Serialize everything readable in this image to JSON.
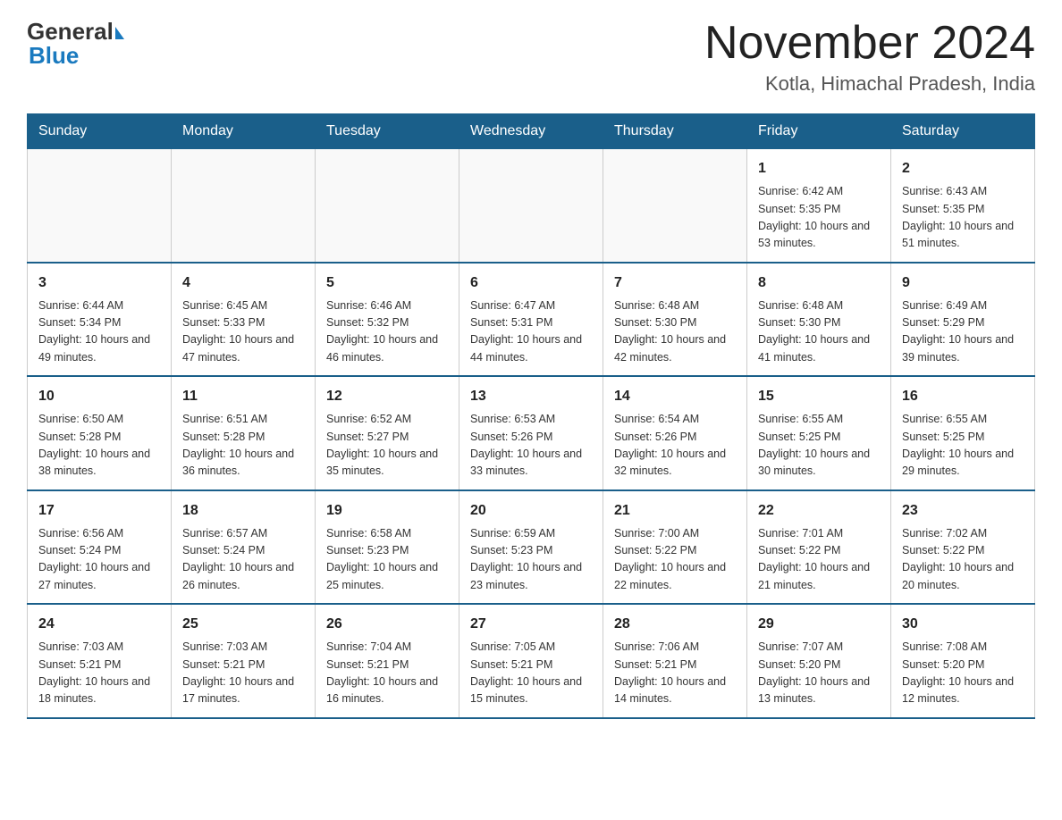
{
  "header": {
    "logo": {
      "general": "General",
      "blue": "Blue"
    },
    "title": "November 2024",
    "subtitle": "Kotla, Himachal Pradesh, India"
  },
  "calendar": {
    "days_of_week": [
      "Sunday",
      "Monday",
      "Tuesday",
      "Wednesday",
      "Thursday",
      "Friday",
      "Saturday"
    ],
    "weeks": [
      {
        "days": [
          {
            "number": "",
            "info": ""
          },
          {
            "number": "",
            "info": ""
          },
          {
            "number": "",
            "info": ""
          },
          {
            "number": "",
            "info": ""
          },
          {
            "number": "",
            "info": ""
          },
          {
            "number": "1",
            "info": "Sunrise: 6:42 AM\nSunset: 5:35 PM\nDaylight: 10 hours and 53 minutes."
          },
          {
            "number": "2",
            "info": "Sunrise: 6:43 AM\nSunset: 5:35 PM\nDaylight: 10 hours and 51 minutes."
          }
        ]
      },
      {
        "days": [
          {
            "number": "3",
            "info": "Sunrise: 6:44 AM\nSunset: 5:34 PM\nDaylight: 10 hours and 49 minutes."
          },
          {
            "number": "4",
            "info": "Sunrise: 6:45 AM\nSunset: 5:33 PM\nDaylight: 10 hours and 47 minutes."
          },
          {
            "number": "5",
            "info": "Sunrise: 6:46 AM\nSunset: 5:32 PM\nDaylight: 10 hours and 46 minutes."
          },
          {
            "number": "6",
            "info": "Sunrise: 6:47 AM\nSunset: 5:31 PM\nDaylight: 10 hours and 44 minutes."
          },
          {
            "number": "7",
            "info": "Sunrise: 6:48 AM\nSunset: 5:30 PM\nDaylight: 10 hours and 42 minutes."
          },
          {
            "number": "8",
            "info": "Sunrise: 6:48 AM\nSunset: 5:30 PM\nDaylight: 10 hours and 41 minutes."
          },
          {
            "number": "9",
            "info": "Sunrise: 6:49 AM\nSunset: 5:29 PM\nDaylight: 10 hours and 39 minutes."
          }
        ]
      },
      {
        "days": [
          {
            "number": "10",
            "info": "Sunrise: 6:50 AM\nSunset: 5:28 PM\nDaylight: 10 hours and 38 minutes."
          },
          {
            "number": "11",
            "info": "Sunrise: 6:51 AM\nSunset: 5:28 PM\nDaylight: 10 hours and 36 minutes."
          },
          {
            "number": "12",
            "info": "Sunrise: 6:52 AM\nSunset: 5:27 PM\nDaylight: 10 hours and 35 minutes."
          },
          {
            "number": "13",
            "info": "Sunrise: 6:53 AM\nSunset: 5:26 PM\nDaylight: 10 hours and 33 minutes."
          },
          {
            "number": "14",
            "info": "Sunrise: 6:54 AM\nSunset: 5:26 PM\nDaylight: 10 hours and 32 minutes."
          },
          {
            "number": "15",
            "info": "Sunrise: 6:55 AM\nSunset: 5:25 PM\nDaylight: 10 hours and 30 minutes."
          },
          {
            "number": "16",
            "info": "Sunrise: 6:55 AM\nSunset: 5:25 PM\nDaylight: 10 hours and 29 minutes."
          }
        ]
      },
      {
        "days": [
          {
            "number": "17",
            "info": "Sunrise: 6:56 AM\nSunset: 5:24 PM\nDaylight: 10 hours and 27 minutes."
          },
          {
            "number": "18",
            "info": "Sunrise: 6:57 AM\nSunset: 5:24 PM\nDaylight: 10 hours and 26 minutes."
          },
          {
            "number": "19",
            "info": "Sunrise: 6:58 AM\nSunset: 5:23 PM\nDaylight: 10 hours and 25 minutes."
          },
          {
            "number": "20",
            "info": "Sunrise: 6:59 AM\nSunset: 5:23 PM\nDaylight: 10 hours and 23 minutes."
          },
          {
            "number": "21",
            "info": "Sunrise: 7:00 AM\nSunset: 5:22 PM\nDaylight: 10 hours and 22 minutes."
          },
          {
            "number": "22",
            "info": "Sunrise: 7:01 AM\nSunset: 5:22 PM\nDaylight: 10 hours and 21 minutes."
          },
          {
            "number": "23",
            "info": "Sunrise: 7:02 AM\nSunset: 5:22 PM\nDaylight: 10 hours and 20 minutes."
          }
        ]
      },
      {
        "days": [
          {
            "number": "24",
            "info": "Sunrise: 7:03 AM\nSunset: 5:21 PM\nDaylight: 10 hours and 18 minutes."
          },
          {
            "number": "25",
            "info": "Sunrise: 7:03 AM\nSunset: 5:21 PM\nDaylight: 10 hours and 17 minutes."
          },
          {
            "number": "26",
            "info": "Sunrise: 7:04 AM\nSunset: 5:21 PM\nDaylight: 10 hours and 16 minutes."
          },
          {
            "number": "27",
            "info": "Sunrise: 7:05 AM\nSunset: 5:21 PM\nDaylight: 10 hours and 15 minutes."
          },
          {
            "number": "28",
            "info": "Sunrise: 7:06 AM\nSunset: 5:21 PM\nDaylight: 10 hours and 14 minutes."
          },
          {
            "number": "29",
            "info": "Sunrise: 7:07 AM\nSunset: 5:20 PM\nDaylight: 10 hours and 13 minutes."
          },
          {
            "number": "30",
            "info": "Sunrise: 7:08 AM\nSunset: 5:20 PM\nDaylight: 10 hours and 12 minutes."
          }
        ]
      }
    ]
  }
}
